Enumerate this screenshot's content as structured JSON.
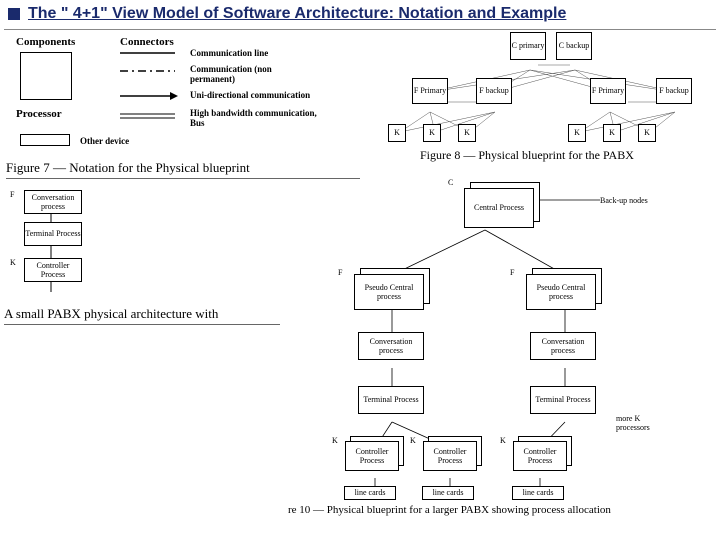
{
  "title": "The \" 4+1\" View Model of Software Architecture: Notation and Example",
  "legend": {
    "components": "Components",
    "connectors": "Connectors",
    "processor": "Processor",
    "other": "Other device",
    "line1": "Communication line",
    "line2": "Communication (non permanent)",
    "line3": "Uni-directional communication",
    "line4": "High bandwidth communication, Bus"
  },
  "fig7": "Figure 7 — Notation for the Physical blueprint",
  "fig8": "Figure 8 — Physical blueprint for the PABX",
  "fig10": "re 10 — Physical blueprint for a larger PABX showing process allocation",
  "midtext": "A small PABX physical architecture with",
  "t": {
    "cprimary": "C primary",
    "cbackup": "C backup",
    "fprimary": "F Primary",
    "fbackup": "F backup",
    "k": "K",
    "f": "F",
    "c": "C",
    "conv": "Conversation process",
    "term": "Terminal Process",
    "ctrl": "Controller Process",
    "central": "Central Process",
    "pcentral": "Pseudo Central process",
    "lc": "line cards",
    "backup": "Back-up nodes",
    "morek": "more K processors"
  }
}
